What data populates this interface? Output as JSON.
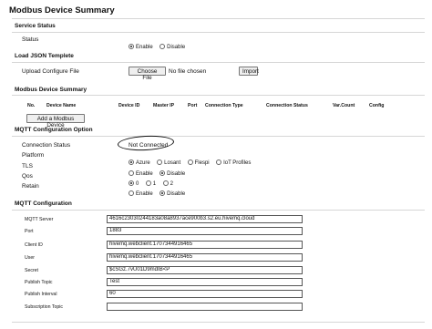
{
  "page_title": "Modbus Device Summary",
  "service_status": {
    "title": "Service Status",
    "label": "Status",
    "options": [
      "Enable",
      "Disable"
    ],
    "selected": "Enable"
  },
  "load_json": {
    "title": "Load JSON Templete",
    "label": "Upload Configure File",
    "choose_file": "Choose File",
    "no_file": "No file chosen",
    "import": "Import"
  },
  "modbus_summary": {
    "title": "Modbus Device Summary",
    "columns": [
      "No.",
      "Device Name",
      "Device ID",
      "Master IP",
      "Port",
      "Connection Type",
      "Connection Status",
      "Var.Count",
      "Config"
    ],
    "add_button": "Add a Modbus Device"
  },
  "mqtt_option": {
    "title": "MQTT Configuration Option",
    "connection_status_label": "Connection Status",
    "connection_status_value": "Not Connected",
    "platform_label": "Platform",
    "platform_options": [
      "Azure",
      "Losant",
      "Flespi",
      "IoT Profiles"
    ],
    "platform_selected": "Azure",
    "tls_label": "TLS",
    "tls_options": [
      "Enable",
      "Disable"
    ],
    "tls_selected": "Disable",
    "qos_label": "Qos",
    "qos_options": [
      "0",
      "1",
      "2"
    ],
    "qos_selected": "0",
    "retain_label": "Retain",
    "retain_options": [
      "Enable",
      "Disable"
    ],
    "retain_selected": "Disable"
  },
  "mqtt_config": {
    "title": "MQTT Configuration",
    "fields": [
      {
        "label": "MQTT Server",
        "value": "4616c23030244183a08a8937ace900b3.s2.eu.hivemq.cloud"
      },
      {
        "label": "Port",
        "value": "1883"
      },
      {
        "label": "Client ID",
        "value": "hivemq.webclient.1707344916465"
      },
      {
        "label": "User",
        "value": "hivemq.webclient.1707344916465"
      },
      {
        "label": "Secret",
        "value": "$cSGz.7vU01D9mdIB<P"
      },
      {
        "label": "Publish Topic",
        "value": "Test"
      },
      {
        "label": "Publish Interval",
        "value": "60"
      },
      {
        "label": "Subscription Topic",
        "value": ""
      }
    ]
  }
}
